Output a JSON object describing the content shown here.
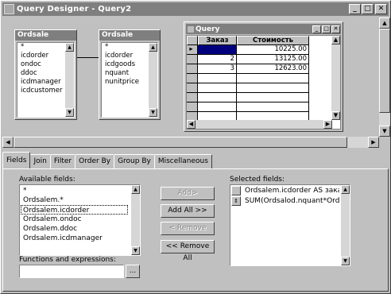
{
  "window": {
    "title": "Query Designer - Query2"
  },
  "tables": [
    {
      "title": "Ordsale",
      "fields": [
        "*",
        "icdorder",
        "ondoc",
        "ddoc",
        "icdmanager",
        "icdcustomer"
      ]
    },
    {
      "title": "Ordsale",
      "fields": [
        "*",
        "icdorder",
        "icdgoods",
        "nquant",
        "nunitprice"
      ]
    }
  ],
  "query": {
    "title": "Query",
    "columns": [
      "Заказ",
      "Стоимость"
    ],
    "rows": [
      [
        "1",
        "10225.00"
      ],
      [
        "2",
        "13125.00"
      ],
      [
        "3",
        "12623.00"
      ]
    ]
  },
  "tabs": [
    "Fields",
    "Join",
    "Filter",
    "Order By",
    "Group By",
    "Miscellaneous"
  ],
  "fields_panel": {
    "available_label": "Available fields:",
    "available": [
      "*",
      "Ordsalem.*",
      "Ordsalem.icdorder",
      "Ordsalem.ondoc",
      "Ordsalem.ddoc",
      "Ordsalem.icdmanager"
    ],
    "selected_label": "Selected fields:",
    "selected": [
      "Ordsalem.icdorder AS зака",
      "SUM(Ordsalod.nquant*Ord"
    ],
    "functions_label": "Functions and expressions:",
    "functions_value": "",
    "browse_label": "...",
    "buttons": {
      "add": "Add>",
      "add_all": "Add All >>",
      "remove": "< Remove",
      "remove_all": "<< Remove All"
    }
  }
}
